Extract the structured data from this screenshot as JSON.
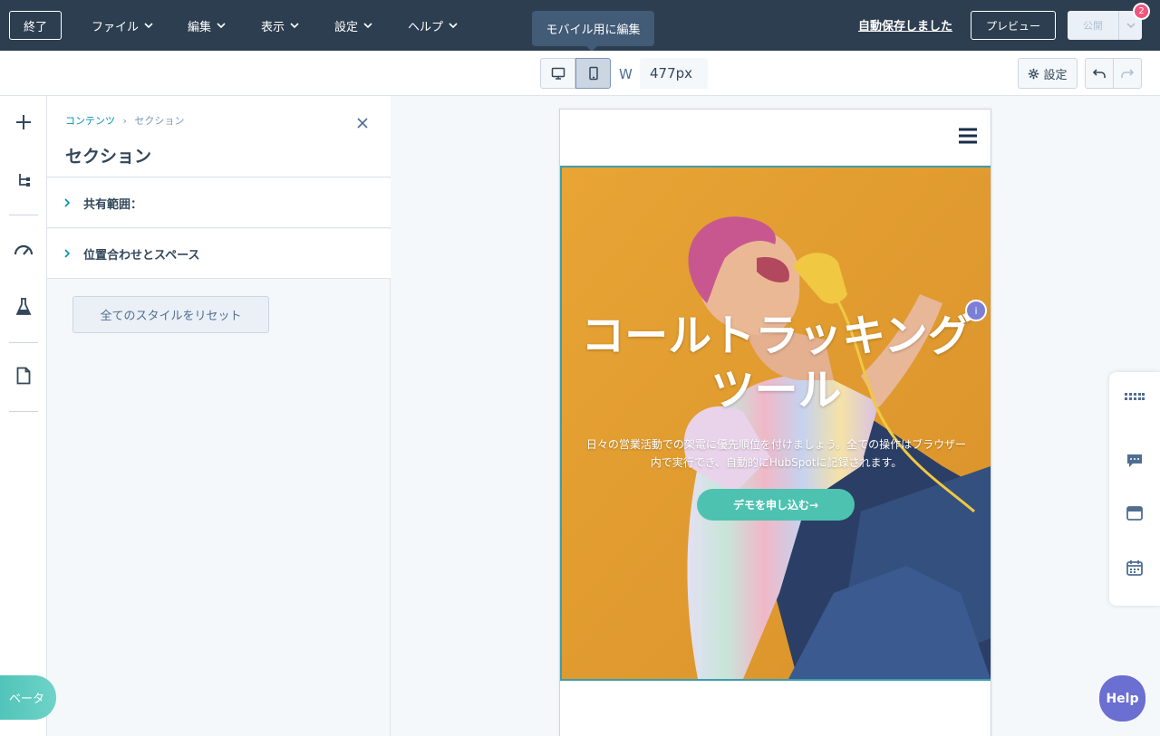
{
  "topbar": {
    "exit_label": "終了",
    "menus": [
      "ファイル",
      "編集",
      "表示",
      "設定",
      "ヘルプ"
    ],
    "tooltip": "モバイル用に編集",
    "autosave": "自動保存しました",
    "preview_label": "プレビュー",
    "publish_label": "公開",
    "notification_count": "2"
  },
  "toolbar": {
    "width_label": "W",
    "width_value": "477px",
    "settings_label": "設定"
  },
  "panel": {
    "breadcrumb_root": "コンテンツ",
    "breadcrumb_sep": "›",
    "breadcrumb_current": "セクション",
    "title": "セクション",
    "accordions": [
      "共有範囲：",
      "位置合わせとスペース"
    ],
    "reset_label": "全てのスタイルをリセット"
  },
  "hero": {
    "title": "コールトラッキングツール",
    "subtitle": "日々の営業活動での架電に優先順位を付けましょう。全ての操作はブラウザー内で実行でき、自動的にHubSpotに記録されます。",
    "cta": "デモを申し込む→",
    "info": "i"
  },
  "floating": {
    "beta_label": "ベータ",
    "help_label": "Help"
  },
  "colors": {
    "topbar": "#2d3e50",
    "hero_bg": "#e59e2e",
    "cta": "#4ec2b0",
    "accent": "#0091ae"
  }
}
